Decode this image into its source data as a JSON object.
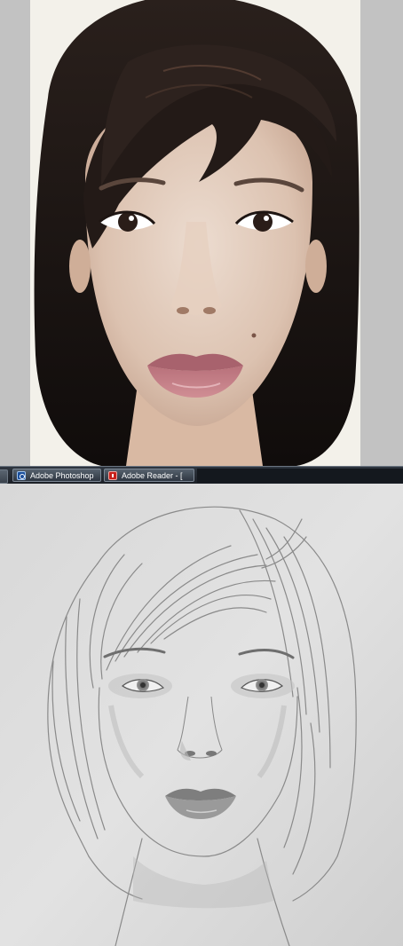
{
  "taskbar": {
    "items": [
      {
        "label": "Adobe Photoshop",
        "icon": "photoshop-icon"
      },
      {
        "label": "Adobe Reader - [",
        "icon": "adobe-reader-icon"
      }
    ]
  },
  "colors": {
    "taskbar_bg": "#1a1e25",
    "photo_bg": "#f3f1ea",
    "paper": "#dcdcdc"
  }
}
